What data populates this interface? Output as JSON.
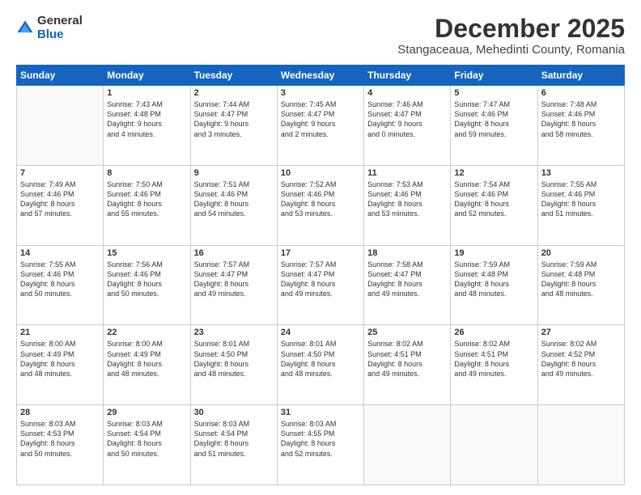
{
  "header": {
    "logo_general": "General",
    "logo_blue": "Blue",
    "main_title": "December 2025",
    "subtitle": "Stangaceaua, Mehedinti County, Romania"
  },
  "calendar": {
    "days_of_week": [
      "Sunday",
      "Monday",
      "Tuesday",
      "Wednesday",
      "Thursday",
      "Friday",
      "Saturday"
    ],
    "weeks": [
      [
        {
          "day": "",
          "info": ""
        },
        {
          "day": "1",
          "info": "Sunrise: 7:43 AM\nSunset: 4:48 PM\nDaylight: 9 hours\nand 4 minutes."
        },
        {
          "day": "2",
          "info": "Sunrise: 7:44 AM\nSunset: 4:47 PM\nDaylight: 9 hours\nand 3 minutes."
        },
        {
          "day": "3",
          "info": "Sunrise: 7:45 AM\nSunset: 4:47 PM\nDaylight: 9 hours\nand 2 minutes."
        },
        {
          "day": "4",
          "info": "Sunrise: 7:46 AM\nSunset: 4:47 PM\nDaylight: 9 hours\nand 0 minutes."
        },
        {
          "day": "5",
          "info": "Sunrise: 7:47 AM\nSunset: 4:46 PM\nDaylight: 8 hours\nand 59 minutes."
        },
        {
          "day": "6",
          "info": "Sunrise: 7:48 AM\nSunset: 4:46 PM\nDaylight: 8 hours\nand 58 minutes."
        }
      ],
      [
        {
          "day": "7",
          "info": "Sunrise: 7:49 AM\nSunset: 4:46 PM\nDaylight: 8 hours\nand 57 minutes."
        },
        {
          "day": "8",
          "info": "Sunrise: 7:50 AM\nSunset: 4:46 PM\nDaylight: 8 hours\nand 55 minutes."
        },
        {
          "day": "9",
          "info": "Sunrise: 7:51 AM\nSunset: 4:46 PM\nDaylight: 8 hours\nand 54 minutes."
        },
        {
          "day": "10",
          "info": "Sunrise: 7:52 AM\nSunset: 4:46 PM\nDaylight: 8 hours\nand 53 minutes."
        },
        {
          "day": "11",
          "info": "Sunrise: 7:53 AM\nSunset: 4:46 PM\nDaylight: 8 hours\nand 53 minutes."
        },
        {
          "day": "12",
          "info": "Sunrise: 7:54 AM\nSunset: 4:46 PM\nDaylight: 8 hours\nand 52 minutes."
        },
        {
          "day": "13",
          "info": "Sunrise: 7:55 AM\nSunset: 4:46 PM\nDaylight: 8 hours\nand 51 minutes."
        }
      ],
      [
        {
          "day": "14",
          "info": "Sunrise: 7:55 AM\nSunset: 4:46 PM\nDaylight: 8 hours\nand 50 minutes."
        },
        {
          "day": "15",
          "info": "Sunrise: 7:56 AM\nSunset: 4:46 PM\nDaylight: 8 hours\nand 50 minutes."
        },
        {
          "day": "16",
          "info": "Sunrise: 7:57 AM\nSunset: 4:47 PM\nDaylight: 8 hours\nand 49 minutes."
        },
        {
          "day": "17",
          "info": "Sunrise: 7:57 AM\nSunset: 4:47 PM\nDaylight: 8 hours\nand 49 minutes."
        },
        {
          "day": "18",
          "info": "Sunrise: 7:58 AM\nSunset: 4:47 PM\nDaylight: 8 hours\nand 49 minutes."
        },
        {
          "day": "19",
          "info": "Sunrise: 7:59 AM\nSunset: 4:48 PM\nDaylight: 8 hours\nand 48 minutes."
        },
        {
          "day": "20",
          "info": "Sunrise: 7:59 AM\nSunset: 4:48 PM\nDaylight: 8 hours\nand 48 minutes."
        }
      ],
      [
        {
          "day": "21",
          "info": "Sunrise: 8:00 AM\nSunset: 4:49 PM\nDaylight: 8 hours\nand 48 minutes."
        },
        {
          "day": "22",
          "info": "Sunrise: 8:00 AM\nSunset: 4:49 PM\nDaylight: 8 hours\nand 48 minutes."
        },
        {
          "day": "23",
          "info": "Sunrise: 8:01 AM\nSunset: 4:50 PM\nDaylight: 8 hours\nand 48 minutes."
        },
        {
          "day": "24",
          "info": "Sunrise: 8:01 AM\nSunset: 4:50 PM\nDaylight: 8 hours\nand 48 minutes."
        },
        {
          "day": "25",
          "info": "Sunrise: 8:02 AM\nSunset: 4:51 PM\nDaylight: 8 hours\nand 49 minutes."
        },
        {
          "day": "26",
          "info": "Sunrise: 8:02 AM\nSunset: 4:51 PM\nDaylight: 8 hours\nand 49 minutes."
        },
        {
          "day": "27",
          "info": "Sunrise: 8:02 AM\nSunset: 4:52 PM\nDaylight: 8 hours\nand 49 minutes."
        }
      ],
      [
        {
          "day": "28",
          "info": "Sunrise: 8:03 AM\nSunset: 4:53 PM\nDaylight: 8 hours\nand 50 minutes."
        },
        {
          "day": "29",
          "info": "Sunrise: 8:03 AM\nSunset: 4:54 PM\nDaylight: 8 hours\nand 50 minutes."
        },
        {
          "day": "30",
          "info": "Sunrise: 8:03 AM\nSunset: 4:54 PM\nDaylight: 8 hours\nand 51 minutes."
        },
        {
          "day": "31",
          "info": "Sunrise: 8:03 AM\nSunset: 4:55 PM\nDaylight: 8 hours\nand 52 minutes."
        },
        {
          "day": "",
          "info": ""
        },
        {
          "day": "",
          "info": ""
        },
        {
          "day": "",
          "info": ""
        }
      ]
    ]
  }
}
